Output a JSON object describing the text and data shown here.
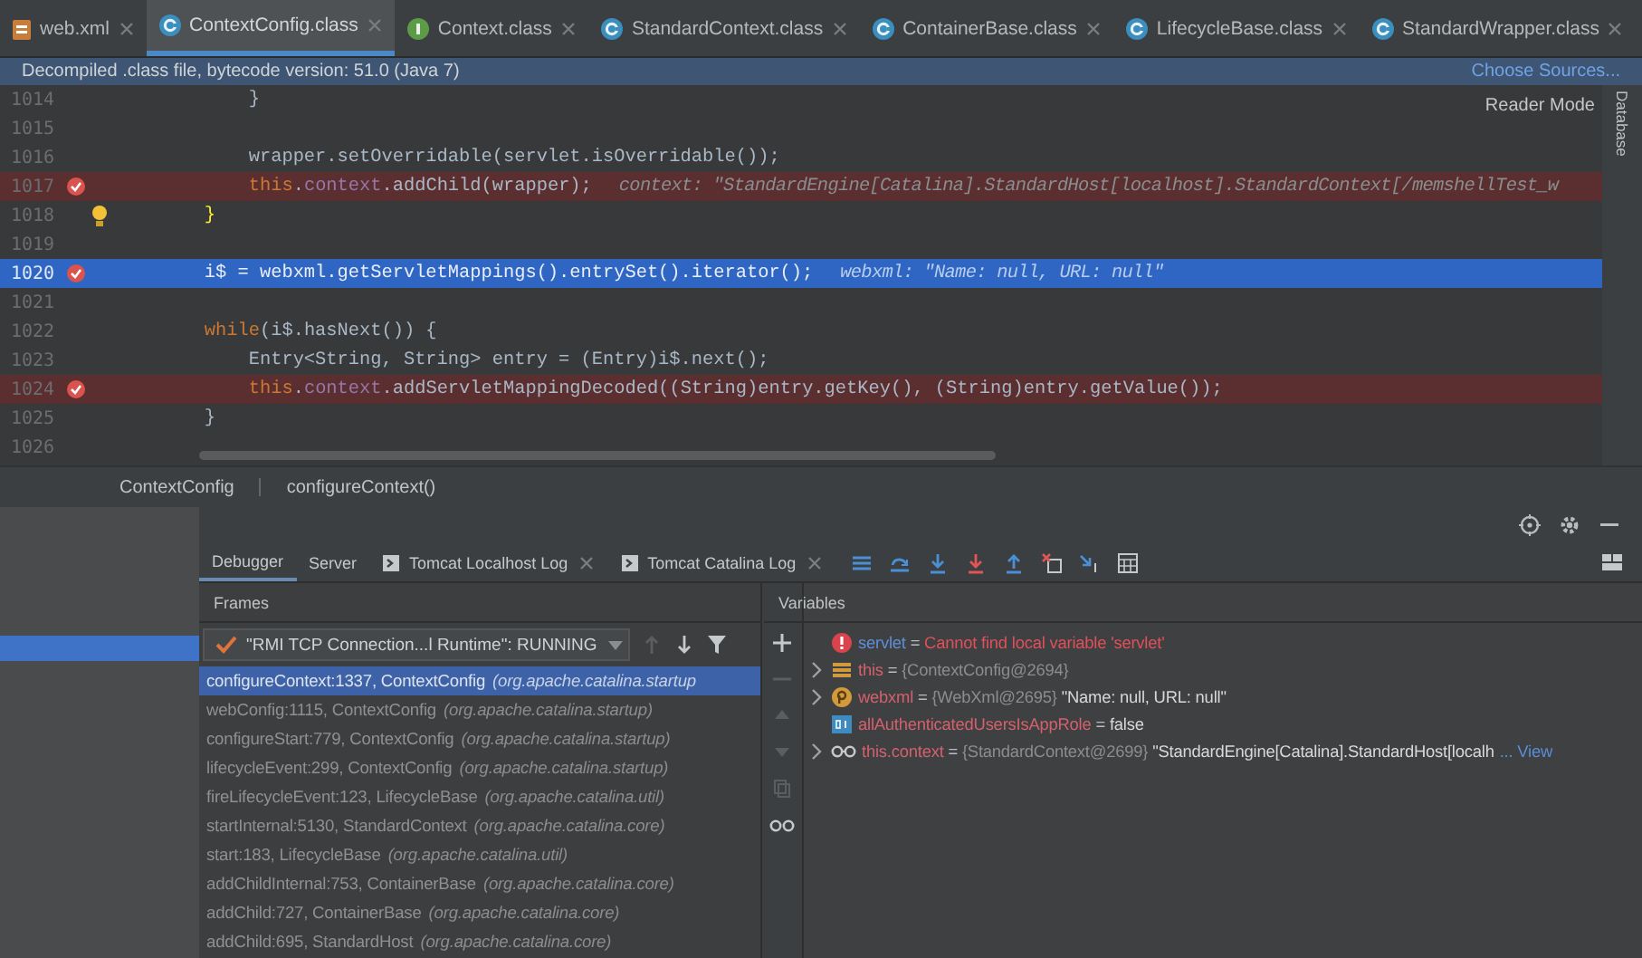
{
  "editor_tabs": [
    {
      "label": "web.xml",
      "kind": "xml",
      "selected": false
    },
    {
      "label": "ContextConfig.class",
      "kind": "class",
      "selected": true
    },
    {
      "label": "Context.class",
      "kind": "interface",
      "selected": false
    },
    {
      "label": "StandardContext.class",
      "kind": "class",
      "selected": false
    },
    {
      "label": "ContainerBase.class",
      "kind": "class",
      "selected": false
    },
    {
      "label": "LifecycleBase.class",
      "kind": "class",
      "selected": false
    },
    {
      "label": "StandardWrapper.class",
      "kind": "class",
      "selected": false
    }
  ],
  "notice": {
    "text": "Decompiled .class file, bytecode version: 51.0 (Java 7)",
    "link": "Choose Sources..."
  },
  "reader_mode": "Reader Mode",
  "side_tool": "Database",
  "code_lines": [
    {
      "number": "1014",
      "breakpoint": false,
      "bulb": false,
      "kind": "normal",
      "segments": [
        {
          "kind": "plain",
          "text": "            }"
        }
      ]
    },
    {
      "number": "1015",
      "breakpoint": false,
      "bulb": false,
      "kind": "normal"
    },
    {
      "number": "1016",
      "breakpoint": false,
      "bulb": false,
      "kind": "normal",
      "segments": [
        {
          "kind": "plain",
          "text": "            wrapper.setOverridable(servlet.isOverridable());"
        }
      ]
    },
    {
      "number": "1017",
      "breakpoint": true,
      "bulb": false,
      "kind": "error",
      "segments": [
        {
          "kind": "keyword",
          "text": "            this"
        },
        {
          "kind": "plain",
          "text": "."
        },
        {
          "kind": "field",
          "text": "context"
        },
        {
          "kind": "plain",
          "text": ".addChild(wrapper);"
        }
      ],
      "hint": "context: \"StandardEngine[Catalina].StandardHost[localhost].StandardContext[/memshellTest_w"
    },
    {
      "number": "1018",
      "breakpoint": false,
      "bulb": true,
      "kind": "normal",
      "segments": [
        {
          "kind": "brace",
          "text": "        }"
        }
      ]
    },
    {
      "number": "1019",
      "breakpoint": false,
      "bulb": false,
      "kind": "normal"
    },
    {
      "number": "1020",
      "breakpoint": true,
      "bulb": false,
      "kind": "current",
      "segments": [
        {
          "kind": "plain",
          "text": "        i$ = webxml.getServletMappings().entrySet().iterator();"
        }
      ],
      "hint": "webxml: \"Name: null, URL: null\""
    },
    {
      "number": "1021",
      "breakpoint": false,
      "bulb": false,
      "kind": "normal"
    },
    {
      "number": "1022",
      "breakpoint": false,
      "bulb": false,
      "kind": "normal",
      "segments": [
        {
          "kind": "keyword",
          "text": "        while"
        },
        {
          "kind": "plain",
          "text": "(i$.hasNext()) {"
        }
      ]
    },
    {
      "number": "1023",
      "breakpoint": false,
      "bulb": false,
      "kind": "normal",
      "segments": [
        {
          "kind": "plain",
          "text": "            Entry<String, String> entry = (Entry)i$.next();"
        }
      ]
    },
    {
      "number": "1024",
      "breakpoint": true,
      "bulb": false,
      "kind": "error",
      "segments": [
        {
          "kind": "keyword",
          "text": "            this"
        },
        {
          "kind": "plain",
          "text": "."
        },
        {
          "kind": "field",
          "text": "context"
        },
        {
          "kind": "plain",
          "text": ".addServletMappingDecoded((String)entry.getKey(), (String)entry.getValue());"
        }
      ]
    },
    {
      "number": "1025",
      "breakpoint": false,
      "bulb": false,
      "kind": "normal",
      "segments": [
        {
          "kind": "plain",
          "text": "        }"
        }
      ]
    },
    {
      "number": "1026",
      "breakpoint": false,
      "bulb": false,
      "kind": "normal"
    }
  ],
  "breadcrumb": [
    "ContextConfig",
    "configureContext()"
  ],
  "debug_tabs": [
    {
      "label": "Debugger",
      "kind": "plain",
      "selected": true
    },
    {
      "label": "Server",
      "kind": "plain",
      "selected": false
    },
    {
      "label": "Tomcat Localhost Log",
      "kind": "log",
      "selected": false
    },
    {
      "label": "Tomcat Catalina Log",
      "kind": "log",
      "selected": false
    }
  ],
  "frames": {
    "title": "Frames",
    "thread": "\"RMI TCP Connection...l Runtime\": RUNNING",
    "items": [
      {
        "method": "configureContext:1337, ContextConfig",
        "package": "(org.apache.catalina.startup",
        "selected": true
      },
      {
        "method": "webConfig:1115, ContextConfig",
        "package": "(org.apache.catalina.startup)",
        "selected": false
      },
      {
        "method": "configureStart:779, ContextConfig",
        "package": "(org.apache.catalina.startup)",
        "selected": false
      },
      {
        "method": "lifecycleEvent:299, ContextConfig",
        "package": "(org.apache.catalina.startup)",
        "selected": false
      },
      {
        "method": "fireLifecycleEvent:123, LifecycleBase",
        "package": "(org.apache.catalina.util)",
        "selected": false
      },
      {
        "method": "startInternal:5130, StandardContext",
        "package": "(org.apache.catalina.core)",
        "selected": false
      },
      {
        "method": "start:183, LifecycleBase",
        "package": "(org.apache.catalina.util)",
        "selected": false
      },
      {
        "method": "addChildInternal:753, ContainerBase",
        "package": "(org.apache.catalina.core)",
        "selected": false
      },
      {
        "method": "addChild:727, ContainerBase",
        "package": "(org.apache.catalina.core)",
        "selected": false
      },
      {
        "method": "addChild:695, StandardHost",
        "package": "(org.apache.catalina.core)",
        "selected": false
      }
    ]
  },
  "variables": {
    "title": "Variables",
    "items": [
      {
        "kind": "error",
        "expandable": false,
        "name": "servlet",
        "separator": "=",
        "message": "Cannot find local variable 'servlet'"
      },
      {
        "kind": "object",
        "expandable": true,
        "name": "this",
        "separator": "=",
        "type": "{ContextConfig@2694}"
      },
      {
        "kind": "param",
        "expandable": true,
        "name": "webxml",
        "separator": "=",
        "type": "{WebXml@2695}",
        "value": "\"Name: null, URL: null\""
      },
      {
        "kind": "field",
        "expandable": false,
        "name": "allAuthenticatedUsersIsAppRole",
        "separator": "=",
        "value": "false"
      },
      {
        "kind": "watch",
        "expandable": true,
        "name": "this.context",
        "separator": "=",
        "type": "{StandardContext@2699}",
        "value": "\"StandardEngine[Catalina].StandardHost[localh",
        "link": "... View"
      }
    ]
  }
}
